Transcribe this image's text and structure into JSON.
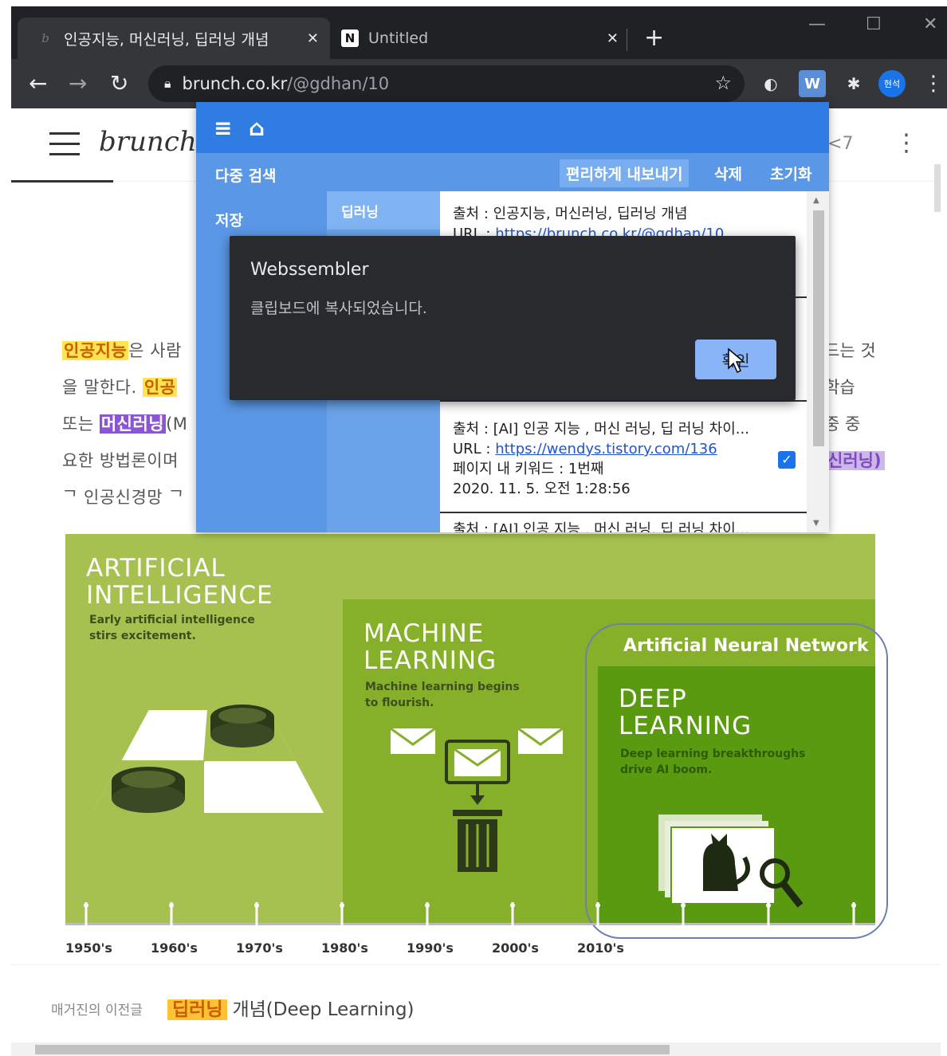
{
  "browser": {
    "tabs": [
      {
        "title": "인공지능, 머신러닝, 딥러닝 개념",
        "favicon": "brunch-icon",
        "close": "✕"
      },
      {
        "title": "Untitled",
        "favicon": "notion-icon",
        "close": "✕"
      }
    ],
    "new_tab": "+",
    "url_domain": "brunch.co.kr",
    "url_path": "/@gdhan/10",
    "profile_initials": "현석",
    "ext_w": "W"
  },
  "page": {
    "logo": "brunch",
    "share_count": "7",
    "article_lines": [
      {
        "hl": "인공지능",
        "text": "은 사람"
      },
      {
        "pre": "을 말한다. ",
        "hl": "인공"
      },
      {
        "pre": "또는 ",
        "hl": "머신러닝",
        "post": "(M"
      },
      {
        "text": "요한 방법론이며"
      },
      {
        "text": "ᄀ 인공신경망 ᄀ"
      }
    ],
    "right_texts": [
      "드는 것",
      "학습",
      "중 중",
      "신러닝)"
    ],
    "graphic": {
      "ai_title": [
        "ARTIFICIAL",
        "INTELLIGENCE"
      ],
      "ai_sub": [
        "Early artificial intelligence",
        "stirs excitement."
      ],
      "ml_title": [
        "MACHINE",
        "LEARNING"
      ],
      "ml_sub": [
        "Machine learning begins",
        "to flourish."
      ],
      "ann_title": "Artificial Neural Network",
      "dl_title": [
        "DEEP",
        "LEARNING"
      ],
      "dl_sub": [
        "Deep learning breakthroughs",
        "drive AI boom."
      ],
      "years": [
        "1950's",
        "1960's",
        "1970's",
        "1980's",
        "1990's",
        "2000's",
        "2010's"
      ]
    },
    "prev_label": "매거진의 이전글",
    "prev_hl": "딥러닝",
    "prev_title": "개념(Deep Learning)"
  },
  "popup": {
    "side": [
      "다중 검색",
      "저장"
    ],
    "actions": {
      "export": "편리하게 내보내기",
      "delete": "삭제",
      "reset": "초기화"
    },
    "keyword": "딥러닝",
    "results": [
      {
        "source": "출처 : 인공지능, 머신러닝, 딥러닝 개념",
        "url_label": "URL : ",
        "url": "https://brunch.co.kr/@gdhan/10"
      },
      {
        "source": "출처 : [AI] 인공 지능 , 머신 러닝, 딥 러닝 차이...",
        "url_label": "URL : ",
        "url": "https://wendys.tistory.com/136",
        "keyword_pos": "페이지 내 키워드 : 1번째",
        "date": "2020. 11. 5. 오전 1:28:56",
        "checked": true
      },
      {
        "source": "출처 : [AI] 인공 지능 , 머신 러닝, 딥 러닝 차이..."
      }
    ]
  },
  "alert": {
    "title": "Webssembler",
    "message": "클립보드에 복사되었습니다.",
    "ok": "확인"
  }
}
